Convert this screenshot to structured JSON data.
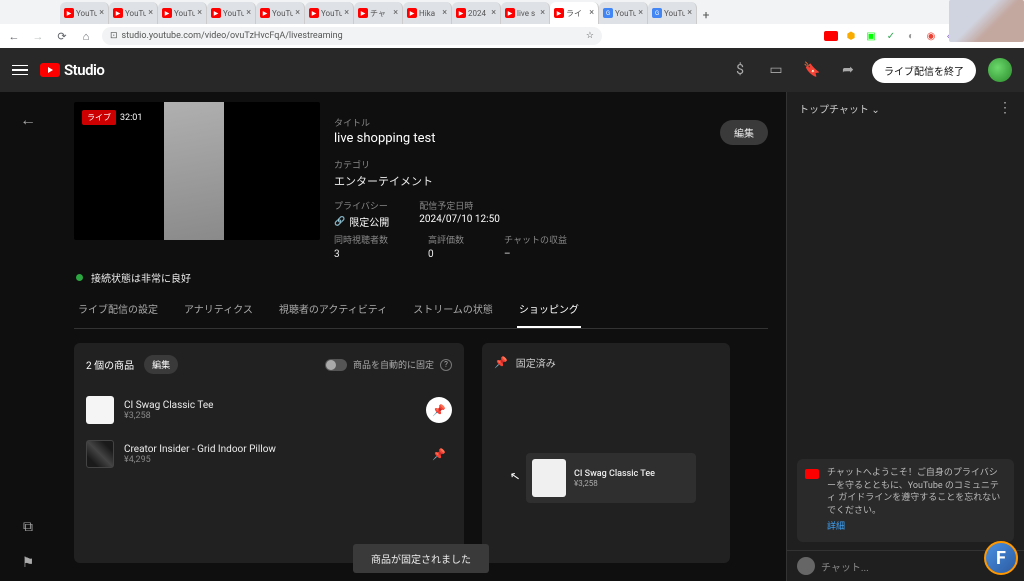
{
  "browser": {
    "url": "studio.youtube.com/video/ovuTzHvcFqA/livestreaming",
    "tabs": [
      {
        "icon": "yt",
        "label": "YouTu"
      },
      {
        "icon": "yt",
        "label": "YouTu"
      },
      {
        "icon": "yt",
        "label": "YouTu"
      },
      {
        "icon": "yt",
        "label": "YouTu"
      },
      {
        "icon": "yt",
        "label": "YouTu"
      },
      {
        "icon": "yt",
        "label": "YouTu"
      },
      {
        "icon": "yt",
        "label": "チャ"
      },
      {
        "icon": "yt",
        "label": "Hika"
      },
      {
        "icon": "yt",
        "label": "2024"
      },
      {
        "icon": "yt",
        "label": "live s"
      },
      {
        "icon": "yt",
        "label": "ライ",
        "active": true
      },
      {
        "icon": "g",
        "label": "YouTu"
      },
      {
        "icon": "g",
        "label": "YouTu"
      }
    ]
  },
  "header": {
    "logo": "Studio",
    "end_stream": "ライブ配信を終了"
  },
  "stream": {
    "live_label": "ライブ",
    "duration": "32:01",
    "title_label": "タイトル",
    "title": "live shopping test",
    "category_label": "カテゴリ",
    "category": "エンターテイメント",
    "privacy_label": "プライバシー",
    "privacy": "限定公開",
    "schedule_label": "配信予定日時",
    "schedule": "2024/07/10 12:50",
    "edit": "編集",
    "stats": {
      "viewers_label": "同時視聴者数",
      "viewers": "3",
      "likes_label": "高評価数",
      "likes": "0",
      "revenue_label": "チャットの収益",
      "revenue": "–"
    },
    "status": "接続状態は非常に良好"
  },
  "tabs": {
    "settings": "ライブ配信の設定",
    "analytics": "アナリティクス",
    "activity": "視聴者のアクティビティ",
    "health": "ストリームの状態",
    "shopping": "ショッピング"
  },
  "shopping": {
    "count": "2 個の商品",
    "edit": "編集",
    "auto_pin": "商品を自動的に固定",
    "pinned_header": "固定済み",
    "products": [
      {
        "name": "CI Swag Classic Tee",
        "price": "¥3,258"
      },
      {
        "name": "Creator Insider - Grid Indoor Pillow",
        "price": "¥4,295"
      }
    ],
    "pinned": {
      "name": "CI Swag Classic Tee",
      "price": "¥3,258"
    }
  },
  "toast": "商品が固定されました",
  "chat": {
    "header": "トップチャット",
    "welcome": "チャットへようこそ！ご自身のプライバシーを守るとともに、YouTube のコミュニティ ガイドラインを遵守することを忘れないでください。",
    "welcome_link": "詳細",
    "placeholder": "チャット..."
  }
}
